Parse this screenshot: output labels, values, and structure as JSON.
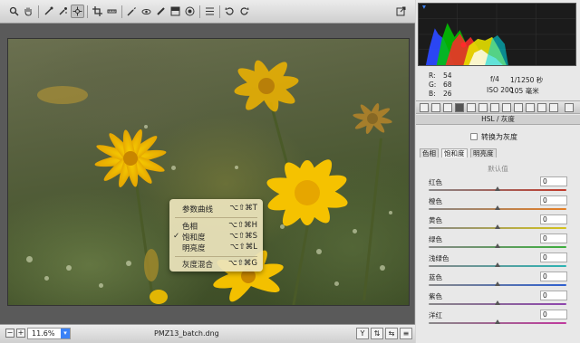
{
  "toolbar": {
    "tools": [
      "zoom-tool",
      "hand-tool",
      "white-balance-tool",
      "color-sampler-tool",
      "targeted-adjustment-tool",
      "crop-tool",
      "straighten-tool",
      "spot-removal-tool",
      "red-eye-tool",
      "adjustment-brush-tool",
      "graduated-filter-tool",
      "radial-filter-tool",
      "preferences",
      "rotate-ccw",
      "rotate-cw"
    ],
    "export_icon": "open-object-icon"
  },
  "context_menu": {
    "items": [
      {
        "label": "参数曲线",
        "shortcut": "⌥⇧⌘T",
        "checked": false
      },
      {
        "label": "色相",
        "shortcut": "⌥⇧⌘H",
        "checked": false
      },
      {
        "label": "饱和度",
        "shortcut": "⌥⇧⌘S",
        "checked": true
      },
      {
        "label": "明亮度",
        "shortcut": "⌥⇧⌘L",
        "checked": false
      },
      {
        "label": "灰度混合",
        "shortcut": "⌥⇧⌘G",
        "checked": false
      }
    ],
    "check_mark": "✓"
  },
  "status": {
    "zoom": "11.6%",
    "filename": "PMZ13_batch.dng",
    "minus": "−",
    "plus": "+"
  },
  "info": {
    "r_label": "R:",
    "r_value": "54",
    "g_label": "G:",
    "g_value": "68",
    "b_label": "B:",
    "b_value": "26",
    "aperture": "f/4",
    "shutter": "1/1250 秒",
    "iso": "ISO 200",
    "focal": "105 毫米"
  },
  "panel": {
    "title": "HSL / 灰度",
    "convert_gray": "转换为灰度",
    "subtabs": [
      "色相",
      "饱和度",
      "明亮度"
    ],
    "selected_subtab": 1,
    "default_link": "默认值",
    "sliders": [
      {
        "name": "红色",
        "value": "0",
        "color": "#c0392b"
      },
      {
        "name": "橙色",
        "value": "0",
        "color": "#e67e22"
      },
      {
        "name": "黄色",
        "value": "0",
        "color": "#d4c21c"
      },
      {
        "name": "绿色",
        "value": "0",
        "color": "#3cae3c"
      },
      {
        "name": "浅绿色",
        "value": "0",
        "color": "#2bb3b3"
      },
      {
        "name": "蓝色",
        "value": "0",
        "color": "#2d5fd0"
      },
      {
        "name": "紫色",
        "value": "0",
        "color": "#8e44ad"
      },
      {
        "name": "洋红",
        "value": "0",
        "color": "#c0399e"
      }
    ]
  },
  "colors": {
    "accent": "#3b82f6",
    "menu_bg": "#ece4bc",
    "flower_yellow": "#f5c400"
  }
}
